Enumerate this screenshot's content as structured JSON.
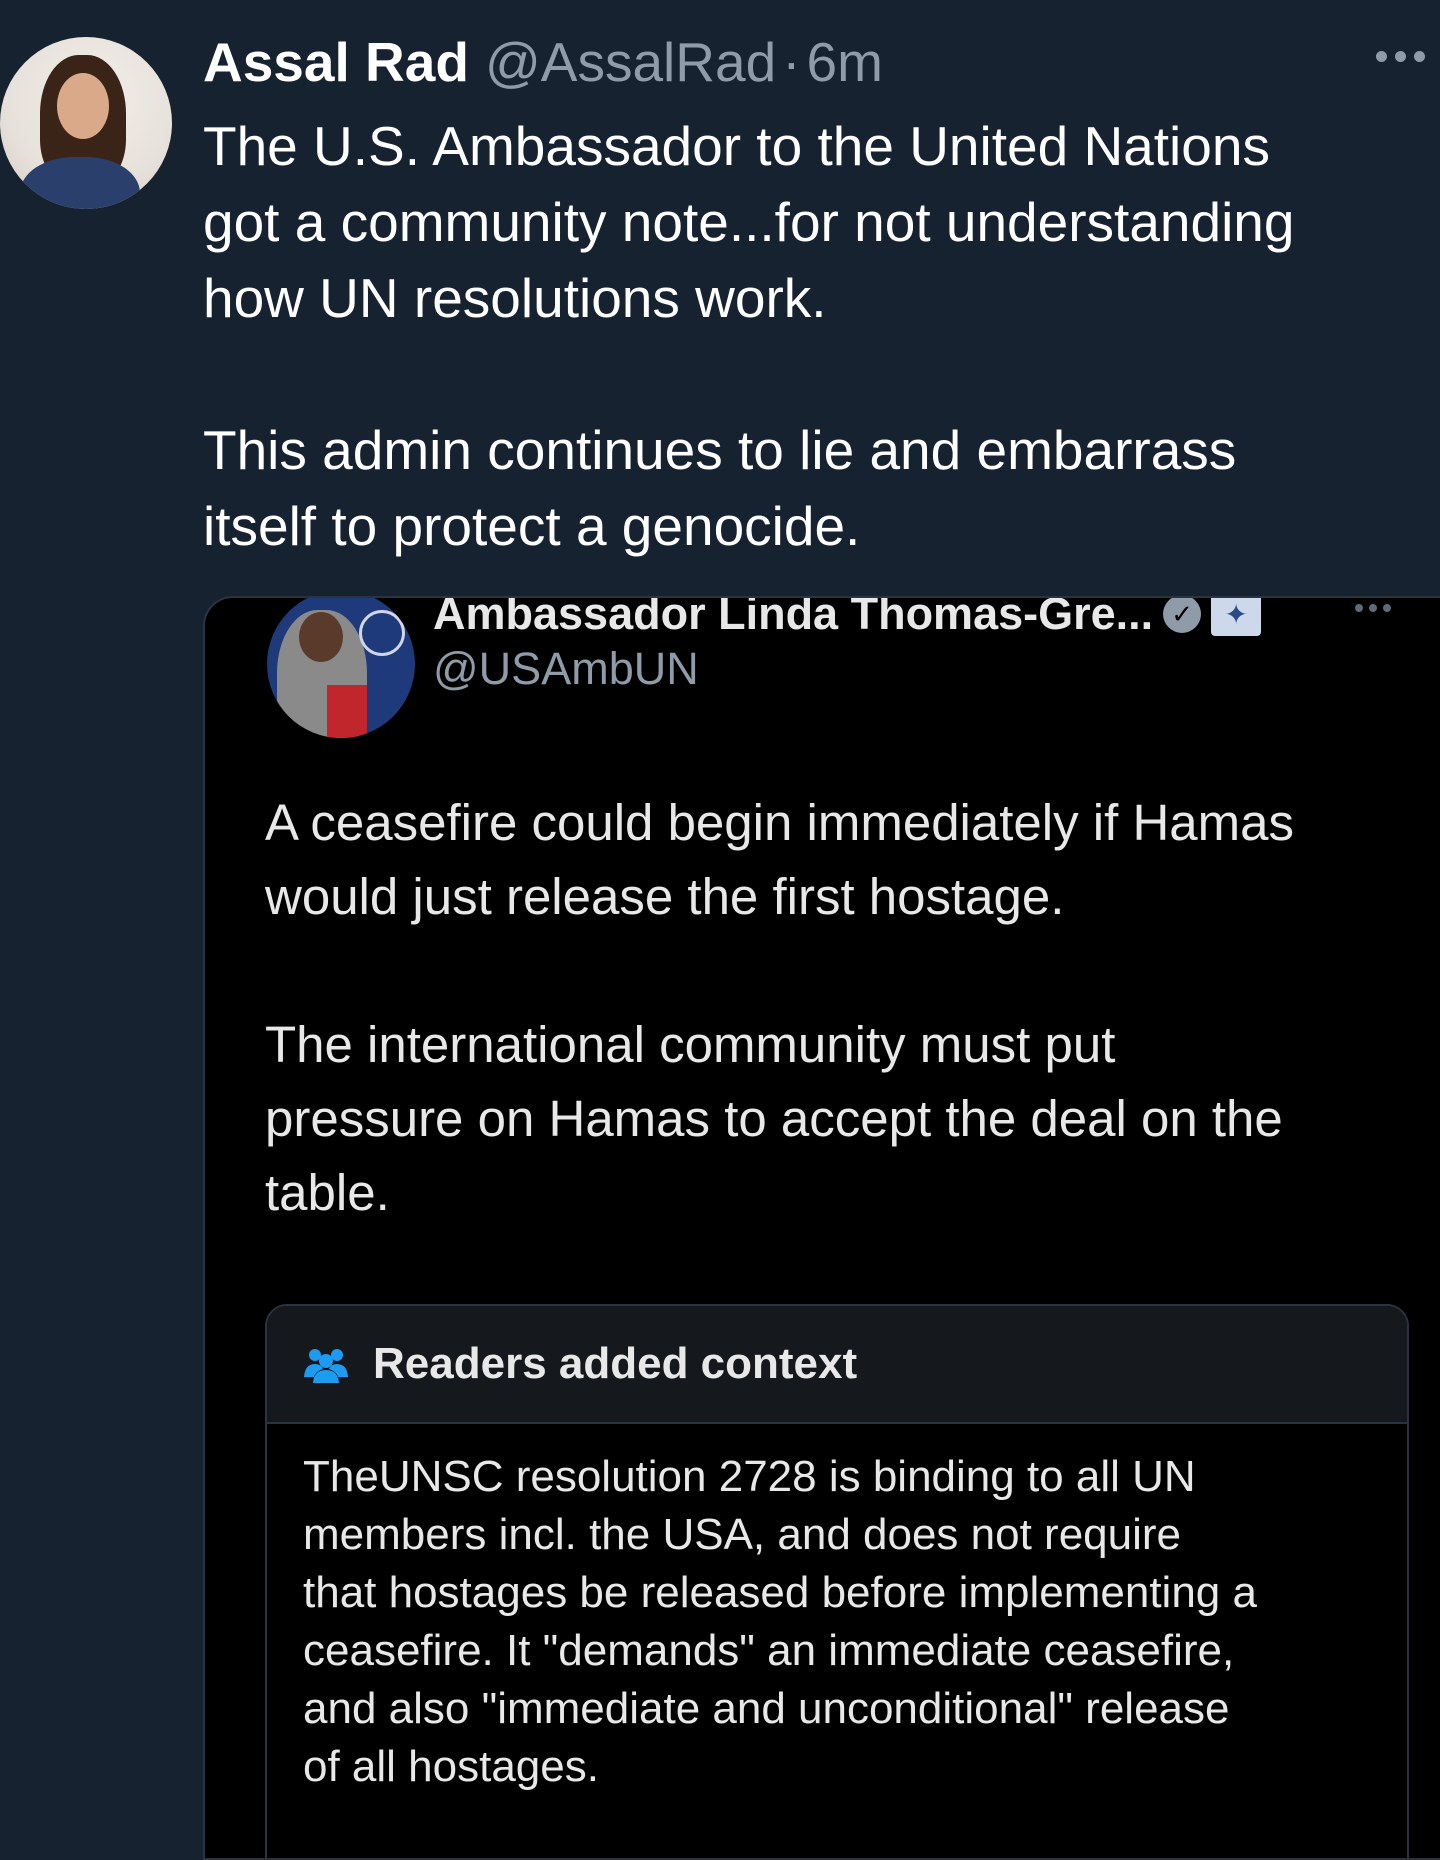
{
  "tweet": {
    "author_name": "Assal Rad",
    "author_handle": "@AssalRad",
    "separator": "·",
    "timestamp": "6m",
    "text": "The U.S. Ambassador to the United Nations\ngot a community note...for not understanding\nhow UN resolutions work.\n\nThis admin continues to lie and embarrass\nitself to protect a genocide."
  },
  "quoted_tweet": {
    "author_name": "Ambassador Linda Thomas-Gre...",
    "author_handle": "@USAmbUN",
    "text": "A ceasefire could begin immediately if Hamas\nwould just release the first hostage.\n\nThe international community must put\npressure on Hamas to accept the deal on the\ntable.",
    "community_note": {
      "title": "Readers added context",
      "body": "TheUNSC resolution 2728 is binding to all UN\nmembers incl. the USA, and does not require\nthat hostages be released before implementing a\nceasefire. It \"demands\" an immediate ceasefire,\nand also \"immediate and unconditional\" release\nof all hostages."
    }
  },
  "colors": {
    "background": "#172230",
    "quote_background": "#000000",
    "muted_text": "#8f9ba8",
    "note_icon": "#1d9bf0"
  },
  "icons": {
    "more": "more-horizontal-icon",
    "verified": "verified-badge-icon",
    "government": "government-seal-icon",
    "readers": "readers-icon"
  }
}
